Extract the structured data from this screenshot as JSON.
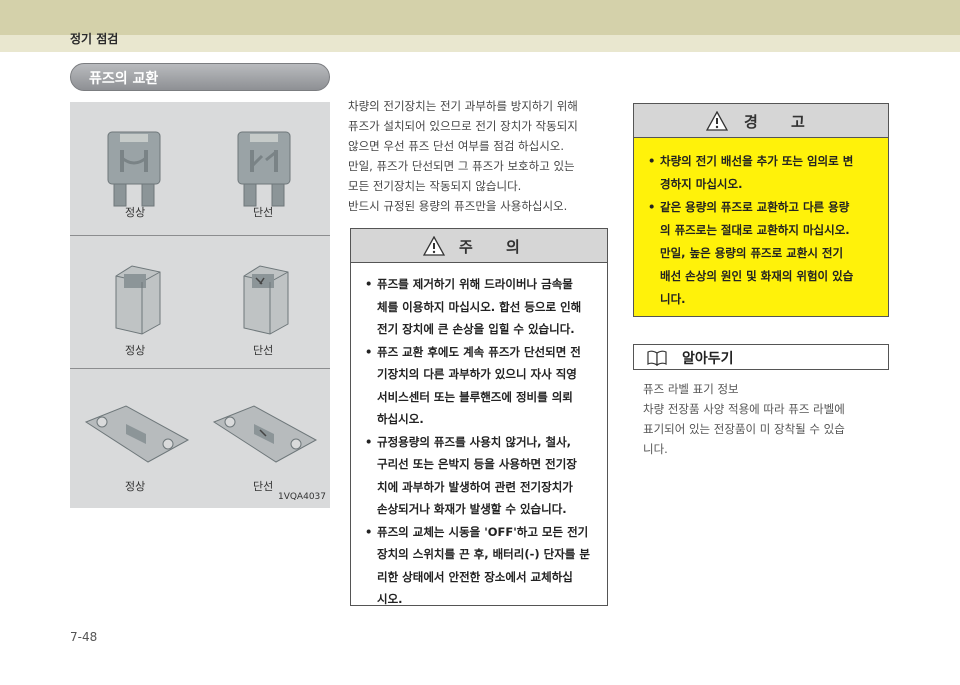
{
  "header": {
    "section": "정기 점검"
  },
  "section_title": "퓨즈의 교환",
  "figure": {
    "rows": [
      {
        "normal": "정상",
        "blown": "단선"
      },
      {
        "normal": "정상",
        "blown": "단선"
      },
      {
        "normal": "정상",
        "blown": "단선"
      }
    ],
    "code": "1VQA4037"
  },
  "body_lines": [
    "차량의 전기장치는 전기 과부하를 방지하기 위해",
    "퓨즈가 설치되어 있으므로 전기 장치가 작동되지",
    "않으면 우선 퓨즈 단선 여부를 점검 하십시오.",
    "만일, 퓨즈가 단선되면 그 퓨즈가 보호하고 있는",
    "모든 전기장치는 작동되지 않습니다.",
    "반드시 규정된 용량의 퓨즈만을 사용하십시오."
  ],
  "caution": {
    "title": "주 의",
    "items": [
      [
        "퓨즈를 제거하기 위해 드라이버나 금속물",
        "체를 이용하지 마십시오. 합선 등으로 인해",
        "전기 장치에 큰 손상을 입힐 수 있습니다."
      ],
      [
        "퓨즈 교환 후에도 계속 퓨즈가 단선되면 전",
        "기장치의 다른 과부하가 있으니 자사 직영",
        "서비스센터 또는 블루핸즈에 정비를 의뢰",
        "하십시오."
      ],
      [
        "규정용량의 퓨즈를 사용치 않거나, 철사,",
        "구리선 또는 은박지 등을 사용하면 전기장",
        "치에 과부하가 발생하여 관련 전기장치가",
        "손상되거나 화재가 발생할 수 있습니다."
      ],
      [
        "퓨즈의 교체는 시동을 'OFF'하고 모든 전기",
        "장치의 스위치를 끈 후, 배터리(-) 단자를 분",
        "리한 상태에서 안전한 장소에서 교체하십",
        "시오."
      ]
    ]
  },
  "warning": {
    "title": "경 고",
    "items": [
      [
        "차량의 전기 배선을 추가 또는 임의로 변",
        "경하지 마십시오."
      ],
      [
        "같은 용량의 퓨즈로 교환하고 다른 용량",
        "의 퓨즈로는 절대로 교환하지 마십시오.",
        "만일, 높은 용량의 퓨즈로 교환시 전기",
        "배선 손상의 원인 및 화재의 위험이 있습",
        "니다."
      ]
    ]
  },
  "note": {
    "label": "알아두기",
    "lines": [
      "퓨즈 라벨 표기 정보",
      "차량 전장품 사양 적용에 따라 퓨즈 라벨에",
      "표기되어 있는 전장품이 미 장착될 수 있습",
      "니다."
    ]
  },
  "page_number": "7-48",
  "icons": [
    "warning-triangle-icon",
    "book-icon"
  ],
  "colors": {
    "warning_bg": "#fff20a",
    "header_band": "#d4d1aa"
  }
}
